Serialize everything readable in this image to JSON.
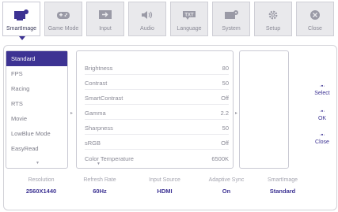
{
  "tabs": [
    {
      "label": "SmartImage",
      "icon": "smartimage-icon",
      "active": true
    },
    {
      "label": "Game Mode",
      "icon": "gamepad-icon",
      "active": false
    },
    {
      "label": "Input",
      "icon": "input-icon",
      "active": false
    },
    {
      "label": "Audio",
      "icon": "speaker-icon",
      "active": false
    },
    {
      "label": "Language",
      "icon": "language-icon",
      "active": false
    },
    {
      "label": "System",
      "icon": "system-icon",
      "active": false
    },
    {
      "label": "Setup",
      "icon": "gear-icon",
      "active": false
    },
    {
      "label": "Close",
      "icon": "close-icon",
      "active": false
    }
  ],
  "modes": {
    "items": [
      "Standard",
      "FPS",
      "Racing",
      "RTS",
      "Movie",
      "LowBlue Mode",
      "EasyRead"
    ],
    "selected_index": 0
  },
  "settings": [
    {
      "name": "Brightness",
      "value": "80"
    },
    {
      "name": "Contrast",
      "value": "50"
    },
    {
      "name": "SmartContrast",
      "value": "Off"
    },
    {
      "name": "Gamma",
      "value": "2.2"
    },
    {
      "name": "Sharpness",
      "value": "50"
    },
    {
      "name": "sRGB",
      "value": "Off"
    },
    {
      "name": "Color Temperature",
      "value": "6500K"
    }
  ],
  "nav": {
    "select": "Select",
    "ok": "OK",
    "close": "Close"
  },
  "status": {
    "resolution_label": "Resolution",
    "resolution_value": "2560X1440",
    "refresh_label": "Refresh Rate",
    "refresh_value": "60Hz",
    "input_label": "Input Source",
    "input_value": "HDMI",
    "sync_label": "Adaptive Sync",
    "sync_value": "On",
    "smartimage_label": "SmartImage",
    "smartimage_value": "Standard"
  },
  "colors": {
    "accent": "#3d3393",
    "text_muted": "#8a8a96",
    "border": "#c9c9d3"
  }
}
